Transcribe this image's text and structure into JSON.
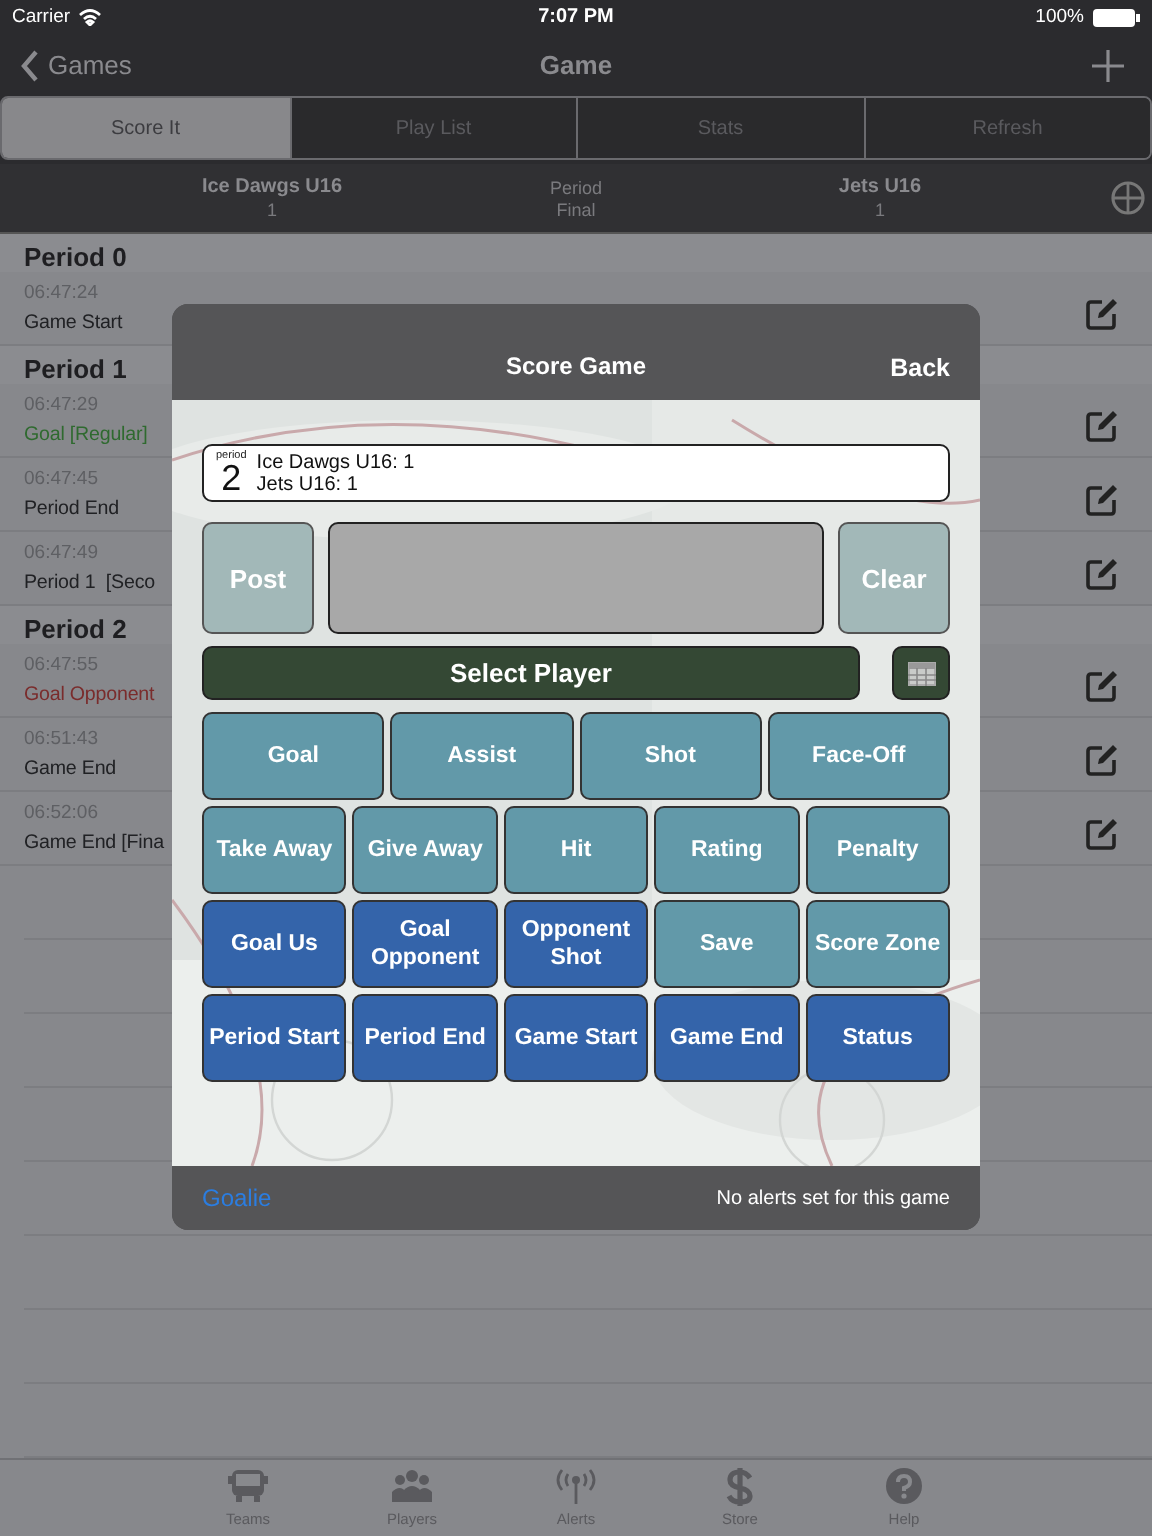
{
  "status_bar": {
    "carrier": "Carrier",
    "time": "7:07 PM",
    "battery": "100%"
  },
  "nav": {
    "back": "Games",
    "title": "Game"
  },
  "segments": [
    {
      "label": "Score It",
      "selected": true
    },
    {
      "label": "Play List",
      "selected": false
    },
    {
      "label": "Stats",
      "selected": false
    },
    {
      "label": "Refresh",
      "selected": false
    }
  ],
  "scoreboard": {
    "home": {
      "name": "Ice Dawgs U16",
      "score": "1"
    },
    "period_label": "Period",
    "period_value": "Final",
    "away": {
      "name": "Jets U16",
      "score": "1"
    }
  },
  "plays": [
    {
      "title": "Period 0",
      "events": [
        {
          "time": "06:47:24",
          "text": "Game Start",
          "color": "#202124"
        }
      ]
    },
    {
      "title": "Period 1",
      "events": [
        {
          "time": "06:47:29",
          "text": "Goal [Regular]",
          "color": "#2f6a2f"
        },
        {
          "time": "06:47:45",
          "text": "Period End",
          "color": "#202124"
        },
        {
          "time": "06:47:49",
          "text": "Period 1  [Seco",
          "color": "#202124"
        }
      ]
    },
    {
      "title": "Period 2",
      "events": [
        {
          "time": "06:47:55",
          "text": "Goal Opponent",
          "color": "#7a2c2c"
        },
        {
          "time": "06:51:43",
          "text": "Game End",
          "color": "#202124"
        },
        {
          "time": "06:52:06",
          "text": "Game End [Fina",
          "color": "#202124"
        }
      ]
    }
  ],
  "dialog": {
    "title": "Score Game",
    "back": "Back",
    "period_label": "period",
    "period": "2",
    "score_lines": [
      "Ice Dawgs U16: 1",
      "Jets U16: 1"
    ],
    "post": "Post",
    "clear": "Clear",
    "select_player": "Select Player",
    "button_rows": [
      [
        {
          "label": "Goal",
          "color": "#6299a9"
        },
        {
          "label": "Assist",
          "color": "#6299a9"
        },
        {
          "label": "Shot",
          "color": "#6299a9"
        },
        {
          "label": "Face-Off",
          "color": "#6299a9"
        }
      ],
      [
        {
          "label": "Take Away",
          "color": "#6299a9"
        },
        {
          "label": "Give Away",
          "color": "#6299a9"
        },
        {
          "label": "Hit",
          "color": "#6299a9"
        },
        {
          "label": "Rating",
          "color": "#6299a9"
        },
        {
          "label": "Penalty",
          "color": "#6299a9"
        }
      ],
      [
        {
          "label": "Goal Us",
          "color": "#3464aa"
        },
        {
          "label": "Goal Opponent",
          "color": "#3464aa"
        },
        {
          "label": "Opponent Shot",
          "color": "#3464aa"
        },
        {
          "label": "Save",
          "color": "#6299a9"
        },
        {
          "label": "Score Zone",
          "color": "#6299a9"
        }
      ],
      [
        {
          "label": "Period Start",
          "color": "#3464aa"
        },
        {
          "label": "Period End",
          "color": "#3464aa"
        },
        {
          "label": "Game Start",
          "color": "#3464aa"
        },
        {
          "label": "Game End",
          "color": "#3464aa"
        },
        {
          "label": "Status",
          "color": "#3464aa"
        }
      ]
    ],
    "footer_link": "Goalie",
    "footer_note": "No alerts set for this game"
  },
  "tab_bar": [
    {
      "label": "Teams"
    },
    {
      "label": "Players"
    },
    {
      "label": "Alerts"
    },
    {
      "label": "Store"
    },
    {
      "label": "Help"
    }
  ]
}
